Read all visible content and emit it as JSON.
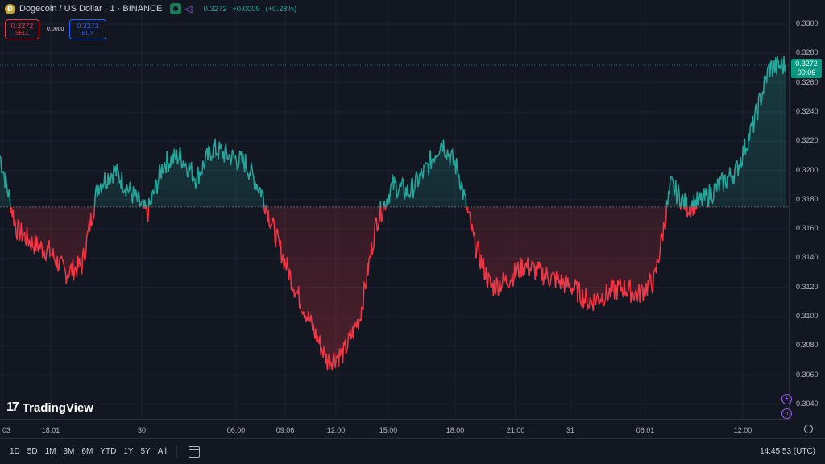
{
  "header": {
    "coin_glyph": "Ð",
    "title": "Dogecoin / US Dollar · 1 · BINANCE",
    "last_price": "0.3272",
    "change": "+0.0009",
    "change_pct": "(+0.28%)"
  },
  "trade": {
    "sell_price": "0.3272",
    "sell_label": "SELL",
    "spread": "0.0000",
    "buy_price": "0.3272",
    "buy_label": "BUY"
  },
  "current_price_tag": {
    "price": "0.3272",
    "countdown": "00:06"
  },
  "logo": {
    "mark": "17",
    "text": "TradingView"
  },
  "price_scale": [
    "0.3300",
    "0.3280",
    "0.3260",
    "0.3240",
    "0.3220",
    "0.3200",
    "0.3180",
    "0.3160",
    "0.3140",
    "0.3120",
    "0.3100",
    "0.3080",
    "0.3060",
    "0.3040"
  ],
  "time_axis": [
    "03",
    "18:01",
    "30",
    "06:00",
    "09:06",
    "12:00",
    "15:00",
    "18:00",
    "21:00",
    "31",
    "06:01",
    "12:00"
  ],
  "bottom_bar": {
    "ranges": [
      "1D",
      "5D",
      "1M",
      "3M",
      "6M",
      "YTD",
      "1Y",
      "5Y",
      "All"
    ],
    "clock": "14:45:53 (UTC)"
  },
  "colors": {
    "up": "#26a69a",
    "down": "#f23645",
    "bg": "#131722",
    "grid": "#1f2330"
  },
  "chart_data": {
    "type": "area",
    "baseline": 0.3175,
    "ylim": [
      0.303,
      0.331
    ],
    "x": [
      "03",
      "18:01",
      "30",
      "06:00",
      "09:06",
      "12:00",
      "15:00",
      "18:00",
      "21:00",
      "31",
      "06:01",
      "12:00"
    ],
    "values": [
      0.321,
      0.316,
      0.315,
      0.3145,
      0.313,
      0.3135,
      0.319,
      0.32,
      0.3185,
      0.317,
      0.3205,
      0.321,
      0.3195,
      0.3215,
      0.321,
      0.3205,
      0.3185,
      0.315,
      0.312,
      0.3095,
      0.307,
      0.3075,
      0.31,
      0.3165,
      0.319,
      0.3185,
      0.32,
      0.322,
      0.32,
      0.315,
      0.312,
      0.3125,
      0.3135,
      0.313,
      0.3125,
      0.312,
      0.311,
      0.3115,
      0.312,
      0.3115,
      0.3125,
      0.319,
      0.3175,
      0.318,
      0.319,
      0.32,
      0.323,
      0.327,
      0.3272
    ]
  }
}
